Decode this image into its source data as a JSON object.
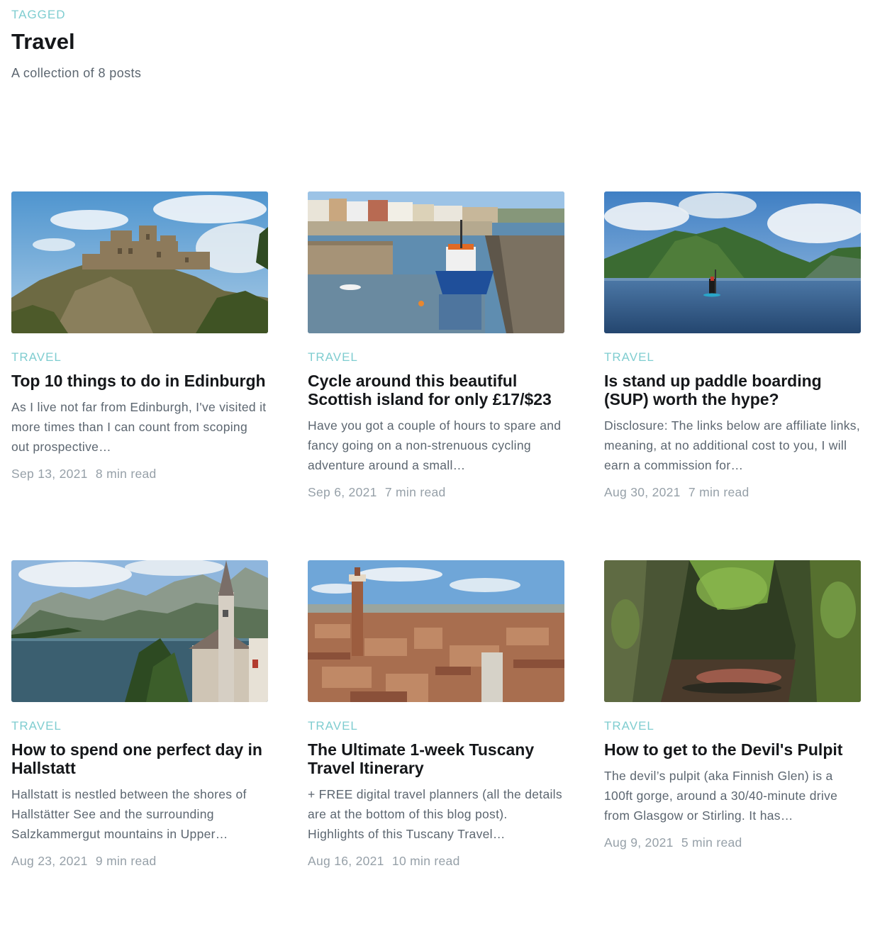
{
  "tag": {
    "eyebrow": "Tagged",
    "title": "Travel",
    "description": "A collection of 8 posts"
  },
  "posts": [
    {
      "tag": "Travel",
      "title": "Top 10 things to do in Edinburgh",
      "excerpt": "As I live not far from Edinburgh, I've visited it more times than I can count from scoping out prospective…",
      "date": "Sep 13, 2021",
      "read_time": "8 min read",
      "image": "edinburgh-castle-image"
    },
    {
      "tag": "Travel",
      "title": "Cycle around this beautiful Scottish island for only £17/$23",
      "excerpt": "Have you got a couple of hours to spare and fancy going on a non-strenuous cycling adventure around a small…",
      "date": "Sep 6, 2021",
      "read_time": "7 min read",
      "image": "harbour-boat-image"
    },
    {
      "tag": "Travel",
      "title": "Is stand up paddle boarding (SUP) worth the hype?",
      "excerpt": "Disclosure: The links below are affiliate links, meaning, at no additional cost to you, I will earn a commission for…",
      "date": "Aug 30, 2021",
      "read_time": "7 min read",
      "image": "paddleboard-loch-image"
    },
    {
      "tag": "Travel",
      "title": "How to spend one perfect day in Hallstatt",
      "excerpt": "Hallstatt is nestled between the shores of Hallstätter See and the surrounding Salzkammergut mountains in Upper…",
      "date": "Aug 23, 2021",
      "read_time": "9 min read",
      "image": "hallstatt-church-image"
    },
    {
      "tag": "Travel",
      "title": "The Ultimate 1-week Tuscany Travel Itinerary",
      "excerpt": "+ FREE digital travel planners (all the details are at the bottom of this blog post). Highlights of this Tuscany Travel…",
      "date": "Aug 16, 2021",
      "read_time": "10 min read",
      "image": "siena-rooftops-image"
    },
    {
      "tag": "Travel",
      "title": "How to get to the Devil's Pulpit",
      "excerpt": "The devil’s pulpit (aka Finnish Glen) is a 100ft gorge, around a 30/40-minute drive from Glasgow or Stirling.  It has…",
      "date": "Aug 9, 2021",
      "read_time": "5 min read",
      "image": "gorge-image"
    }
  ]
}
